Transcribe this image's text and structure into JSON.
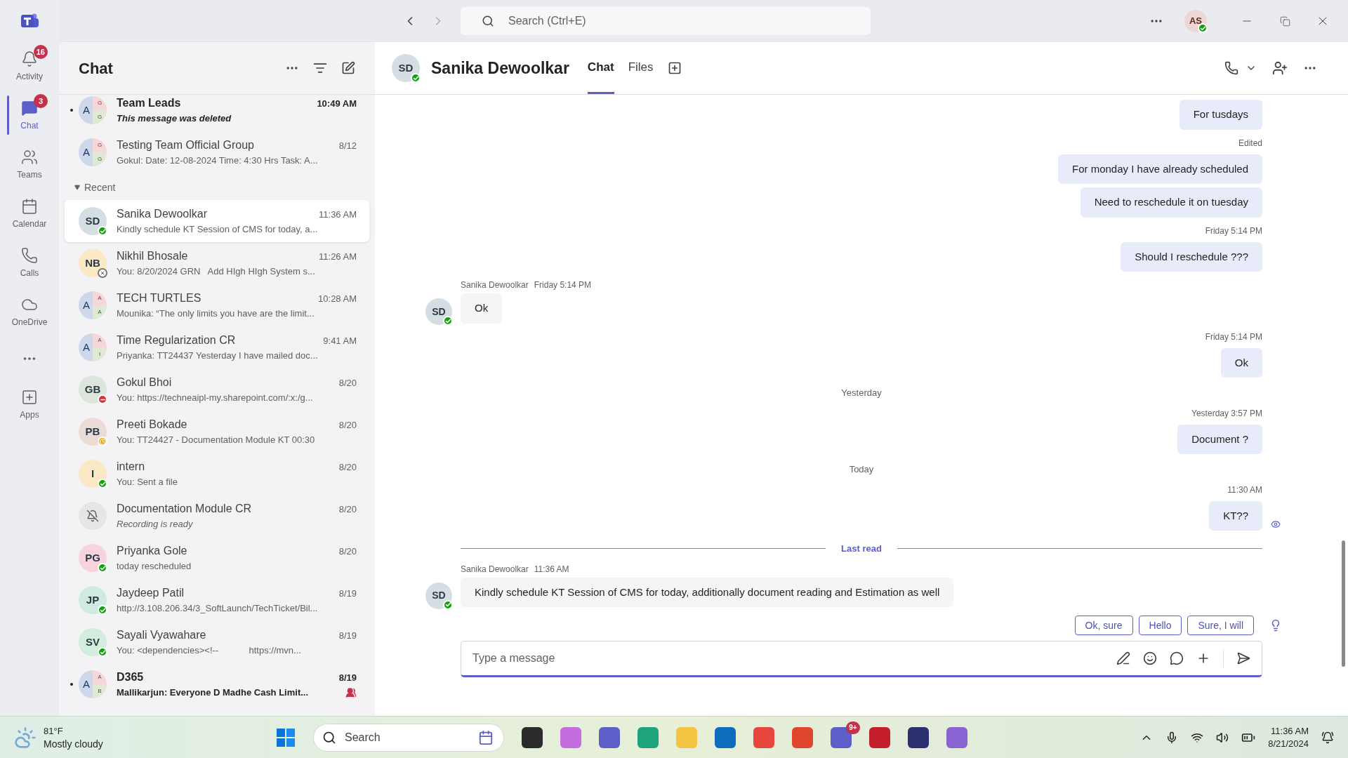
{
  "title_bar": {
    "search": {
      "placeholder": "Search (Ctrl+E)"
    },
    "user": {
      "initials": "AS",
      "status": {
        "kind": "available"
      }
    }
  },
  "rail": {
    "items": [
      {
        "label": "Activity",
        "badge": "16",
        "selected": false
      },
      {
        "label": "Chat",
        "badge": "3",
        "selected": true
      },
      {
        "label": "Teams",
        "selected": false
      },
      {
        "label": "Calendar",
        "selected": false
      },
      {
        "label": "Calls",
        "selected": false
      },
      {
        "label": "OneDrive",
        "selected": false
      },
      {
        "label": "Apps",
        "selected": false
      }
    ]
  },
  "chat_list": {
    "title": "Chat",
    "top_items": [
      {
        "name": "Team Leads",
        "time": "10:49 AM",
        "preview": "This message was deleted",
        "avatar": {
          "kind": "group",
          "letter": "A",
          "small": [
            "G",
            "G"
          ]
        },
        "unread": true,
        "system_preview": true,
        "mention": false,
        "selected": false
      },
      {
        "name": "Testing Team Official Group",
        "time": "8/12",
        "preview": "Gokul: Date: 12-08-2024 Time: 4:30 Hrs Task: A...",
        "avatar": {
          "kind": "group",
          "letter": "A",
          "small": [
            "G",
            "G"
          ]
        },
        "unread": false,
        "system_preview": false,
        "mention": false,
        "selected": false
      }
    ],
    "sections": [
      {
        "label": "Recent",
        "expanded": true,
        "items": [
          {
            "name": "Sanika Dewoolkar",
            "time": "11:36 AM",
            "preview": "Kindly schedule KT Session of CMS for today, a...",
            "avatar": {
              "kind": "initials",
              "initials": "SD",
              "color": "#d5dfe3",
              "status": {
                "kind": "available"
              }
            },
            "unread": false,
            "system_preview": false,
            "mention": false,
            "selected": true
          },
          {
            "name": "Nikhil Bhosale",
            "time": "11:26 AM",
            "preview": "You: 8/20/2024 GRN   Add HIgh HIgh System s...",
            "avatar": {
              "kind": "initials",
              "initials": "NB",
              "color": "#fbe8c4",
              "status": {
                "kind": "offline"
              }
            },
            "unread": false,
            "system_preview": false,
            "mention": false,
            "selected": false
          },
          {
            "name": "TECH TURTLES",
            "time": "10:28 AM",
            "preview": "Mounika: “The only limits you have are the limit...",
            "avatar": {
              "kind": "group",
              "letter": "A",
              "small": [
                "A",
                "A"
              ]
            },
            "unread": false,
            "system_preview": false,
            "mention": false,
            "selected": false
          },
          {
            "name": "Time Regularization CR",
            "time": "9:41 AM",
            "preview": "Priyanka: TT24437 Yesterday I have mailed doc...",
            "avatar": {
              "kind": "group",
              "letter": "A",
              "small": [
                "A",
                "I"
              ]
            },
            "unread": false,
            "system_preview": false,
            "mention": false,
            "selected": false
          },
          {
            "name": "Gokul Bhoi",
            "time": "8/20",
            "preview": "You: https://techneaipl-my.sharepoint.com/:x:/g...",
            "avatar": {
              "kind": "initials",
              "initials": "GB",
              "color": "#dde4db",
              "status": {
                "kind": "busy"
              }
            },
            "unread": false,
            "system_preview": false,
            "mention": false,
            "selected": false
          },
          {
            "name": "Preeti Bokade",
            "time": "8/20",
            "preview": "You: TT24427 - Documentation Module KT 00:30",
            "avatar": {
              "kind": "initials",
              "initials": "PB",
              "color": "#ecdcd8",
              "status": {
                "kind": "away"
              }
            },
            "unread": false,
            "system_preview": false,
            "mention": false,
            "selected": false
          },
          {
            "name": "intern",
            "time": "8/20",
            "preview": "You: Sent a file",
            "avatar": {
              "kind": "initials",
              "initials": "I",
              "color": "#fbe9c6",
              "status": {
                "kind": "available"
              }
            },
            "unread": false,
            "system_preview": false,
            "mention": false,
            "selected": false
          },
          {
            "name": "Documentation Module CR",
            "time": "8/20",
            "preview": "Recording is ready",
            "avatar": {
              "kind": "muted"
            },
            "unread": false,
            "system_preview": true,
            "mention": false,
            "selected": false
          },
          {
            "name": "Priyanka Gole",
            "time": "8/20",
            "preview": "today rescheduled",
            "avatar": {
              "kind": "initials",
              "initials": "PG",
              "color": "#f7d3de",
              "status": {
                "kind": "available"
              }
            },
            "unread": false,
            "system_preview": false,
            "mention": false,
            "selected": false
          },
          {
            "name": "Jaydeep Patil",
            "time": "8/19",
            "preview": "http://3.108.206.34/3_SoftLaunch/TechTicket/Bil...",
            "avatar": {
              "kind": "initials",
              "initials": "JP",
              "color": "#cfeade",
              "status": {
                "kind": "available"
              }
            },
            "unread": false,
            "system_preview": false,
            "mention": false,
            "selected": false
          },
          {
            "name": "Sayali Vyawahare",
            "time": "8/19",
            "preview": "You: <dependencies><!--            https://mvn...",
            "avatar": {
              "kind": "initials",
              "initials": "SV",
              "color": "#d2ecdd",
              "status": {
                "kind": "available"
              }
            },
            "unread": false,
            "system_preview": false,
            "mention": false,
            "selected": false
          },
          {
            "name": "D365",
            "time": "8/19",
            "preview": "Mallikarjun: Everyone D Madhe Cash Limit...",
            "avatar": {
              "kind": "group",
              "letter": "A",
              "small": [
                "A",
                "B"
              ]
            },
            "unread": true,
            "system_preview": false,
            "mention": true,
            "selected": false
          }
        ]
      }
    ]
  },
  "conversation": {
    "header": {
      "initials": "SD",
      "status": {
        "kind": "available"
      },
      "name": "Sanika Dewoolkar",
      "tabs": [
        {
          "label": "Chat",
          "selected": true
        },
        {
          "label": "Files",
          "selected": false
        }
      ]
    },
    "messages": [
      {
        "kind": "sent",
        "text": "For tusdays"
      },
      {
        "kind": "sent",
        "meta": "Edited",
        "text": "For monday I have already scheduled"
      },
      {
        "kind": "sent",
        "text": "Need to reschedule it on tuesday"
      },
      {
        "kind": "sent",
        "meta": "Friday 5:14 PM",
        "text": "Should I reschedule ???"
      },
      {
        "kind": "received",
        "sender": "Sanika Dewoolkar",
        "time": "Friday 5:14 PM",
        "initials": "SD",
        "status": {
          "kind": "available"
        },
        "text": "Ok"
      },
      {
        "kind": "sent",
        "meta": "Friday 5:14 PM",
        "text": "Ok"
      },
      {
        "kind": "day",
        "text": "Yesterday"
      },
      {
        "kind": "sent",
        "meta": "Yesterday 3:57 PM",
        "text": "Document ?"
      },
      {
        "kind": "day",
        "text": "Today"
      },
      {
        "kind": "sent",
        "meta": "11:30 AM",
        "text": "KT??",
        "seen": true
      },
      {
        "kind": "divider",
        "text": "Last read"
      },
      {
        "kind": "received",
        "sender": "Sanika Dewoolkar",
        "time": "11:36 AM",
        "initials": "SD",
        "status": {
          "kind": "available"
        },
        "text": "Kindly schedule KT Session of CMS for today, additionally document reading and Estimation as well"
      }
    ],
    "suggested_replies": [
      "Ok, sure",
      "Hello",
      "Sure, I will"
    ],
    "compose": {
      "placeholder": "Type a message"
    }
  },
  "taskbar": {
    "weather": {
      "temp": "81°F",
      "condition": "Mostly cloudy"
    },
    "search": {
      "placeholder": "Search"
    },
    "teams_badge": "9+",
    "clock": {
      "time": "11:36 AM",
      "date": "8/21/2024"
    }
  }
}
